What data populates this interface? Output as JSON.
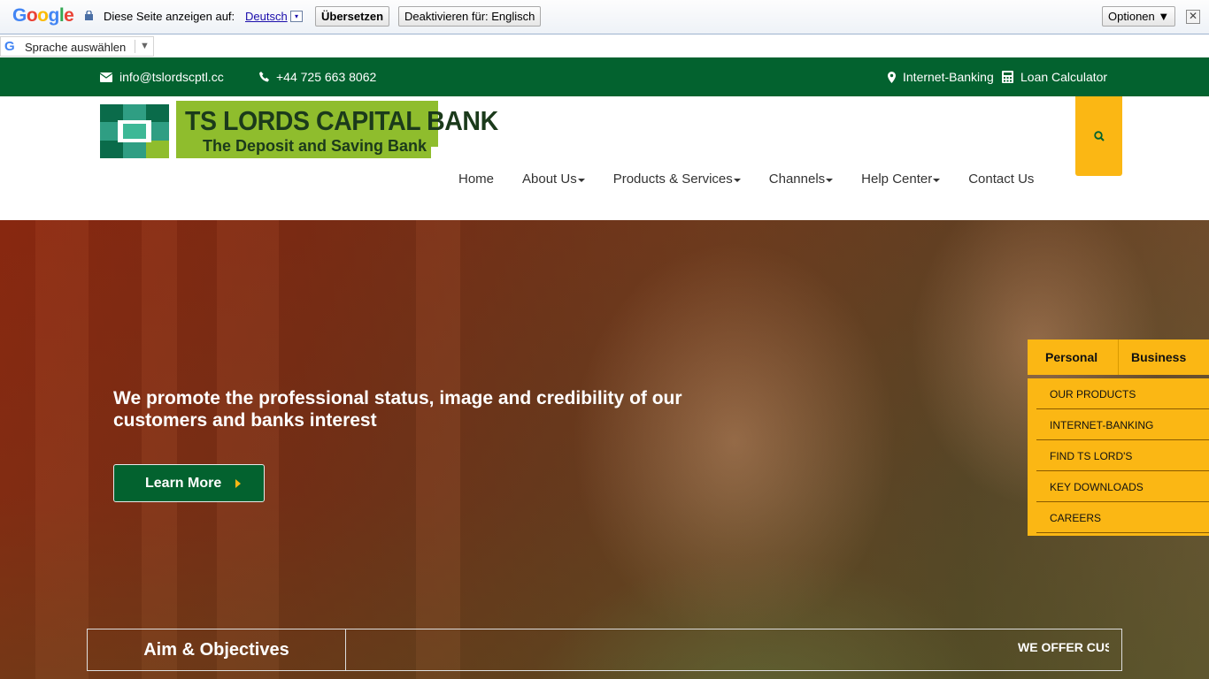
{
  "translate_bar": {
    "logo_text": "Google",
    "prompt": "Diese Seite anzeigen auf:",
    "language": "Deutsch",
    "dropdown_glyph": "▾",
    "translate_button": "Übersetzen",
    "disable_button": "Deaktivieren für: Englisch",
    "options_button": "Optionen ▼",
    "close_glyph": "✕"
  },
  "language_selector": {
    "logo_letter": "G",
    "label": "Sprache auswählen",
    "arrow": "▼"
  },
  "topbar": {
    "email": "info@tslordscptl.cc",
    "phone": "+44 725 663 8062",
    "internet_banking": "Internet-Banking",
    "loan_calculator": "Loan Calculator"
  },
  "logo": {
    "name": "TS LORDS CAPITAL BANK",
    "tagline": "The Deposit and Saving Bank"
  },
  "nav": {
    "items": [
      {
        "label": "Home",
        "dropdown": false
      },
      {
        "label": "About Us",
        "dropdown": true
      },
      {
        "label": "Products & Services",
        "dropdown": true
      },
      {
        "label": "Channels",
        "dropdown": true
      },
      {
        "label": "Help Center",
        "dropdown": true
      },
      {
        "label": "Contact Us",
        "dropdown": false
      }
    ]
  },
  "hero": {
    "title": "We promote the professional status, image and credibility of our customers and banks interest",
    "cta": "Learn More"
  },
  "side_panel": {
    "tabs": [
      "Personal",
      "Business"
    ],
    "links": [
      "OUR PRODUCTS",
      "INTERNET-BANKING",
      "FIND TS LORD'S",
      "KEY DOWNLOADS",
      "CAREERS"
    ]
  },
  "ticker": {
    "heading": "Aim & Objectives",
    "text": "WE OFFER CUS"
  },
  "colors": {
    "brand_green": "#03622f",
    "accent_yellow": "#fbb714",
    "logo_green": "#8fbd2d"
  }
}
